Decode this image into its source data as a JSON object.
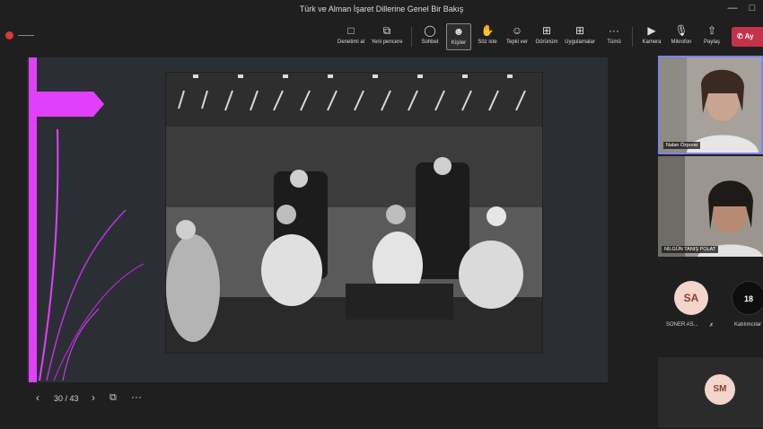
{
  "window": {
    "title": "Türk ve Alman İşaret Dillerine Genel Bir Bakış"
  },
  "toolbar": {
    "buttons": [
      {
        "label": "Denetimi al",
        "icon": "screen-control-icon"
      },
      {
        "label": "Yeni pencere",
        "icon": "new-window-icon"
      },
      {
        "label": "Sohbet",
        "icon": "chat-icon"
      },
      {
        "label": "Kişiler",
        "icon": "people-icon"
      },
      {
        "label": "Söz iste",
        "icon": "raise-hand-icon"
      },
      {
        "label": "Tepki ver",
        "icon": "reaction-icon"
      },
      {
        "label": "Görünüm",
        "icon": "view-icon"
      },
      {
        "label": "Uygulamalar",
        "icon": "apps-icon"
      },
      {
        "label": "Tümü",
        "icon": "more-icon"
      },
      {
        "label": "Kamera",
        "icon": "camera-icon"
      },
      {
        "label": "Mikrofon",
        "icon": "microphone-icon"
      },
      {
        "label": "Paylaş",
        "icon": "share-icon"
      }
    ],
    "leave_label": "Ay"
  },
  "slide": {
    "counter": "30 / 43"
  },
  "participants": {
    "tile1_name": "Nalan Özpınar",
    "tile2_name": "NİLGÜN TANIŞ POLAT",
    "sa_initials": "SA",
    "sa_name": "SONER AS...",
    "more_count": "18",
    "more_label": "Katılımcılar",
    "sm_initials": "SM"
  },
  "colors": {
    "accent_magenta": "#e040fb",
    "active_border": "#7b83eb",
    "leave_red": "#c4314b"
  }
}
